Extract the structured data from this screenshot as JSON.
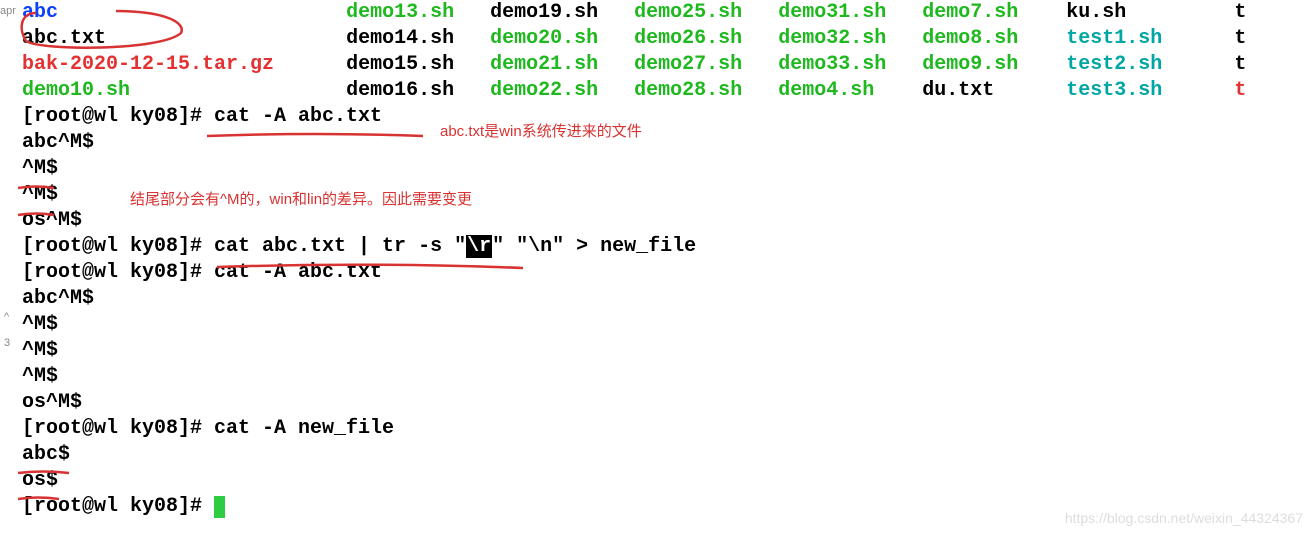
{
  "leftLabels": {
    "a": "apr",
    "b": "^",
    "c": "3"
  },
  "prompt": "[root@wl ky08]# ",
  "ls_rows": [
    [
      {
        "t": "abc",
        "c": "blue"
      },
      {
        "t": "demo13.sh",
        "c": "green"
      },
      {
        "t": "demo19.sh",
        "c": "black"
      },
      {
        "t": "demo25.sh",
        "c": "green"
      },
      {
        "t": "demo31.sh",
        "c": "green"
      },
      {
        "t": "demo7.sh",
        "c": "green"
      },
      {
        "t": "ku.sh",
        "c": "black"
      },
      {
        "t": "t",
        "c": "black"
      }
    ],
    [
      {
        "t": "abc.txt",
        "c": "black"
      },
      {
        "t": "demo14.sh",
        "c": "black"
      },
      {
        "t": "demo20.sh",
        "c": "green"
      },
      {
        "t": "demo26.sh",
        "c": "green"
      },
      {
        "t": "demo32.sh",
        "c": "green"
      },
      {
        "t": "demo8.sh",
        "c": "green"
      },
      {
        "t": "test1.sh",
        "c": "teal"
      },
      {
        "t": "t",
        "c": "black"
      }
    ],
    [
      {
        "t": "bak-2020-12-15.tar.gz",
        "c": "red"
      },
      {
        "t": "demo15.sh",
        "c": "black"
      },
      {
        "t": "demo21.sh",
        "c": "green"
      },
      {
        "t": "demo27.sh",
        "c": "green"
      },
      {
        "t": "demo33.sh",
        "c": "green"
      },
      {
        "t": "demo9.sh",
        "c": "green"
      },
      {
        "t": "test2.sh",
        "c": "teal"
      },
      {
        "t": "t",
        "c": "black"
      }
    ],
    [
      {
        "t": "demo10.sh",
        "c": "green"
      },
      {
        "t": "demo16.sh",
        "c": "black"
      },
      {
        "t": "demo22.sh",
        "c": "green"
      },
      {
        "t": "demo28.sh",
        "c": "green"
      },
      {
        "t": "demo4.sh",
        "c": "green"
      },
      {
        "t": "du.txt",
        "c": "black"
      },
      {
        "t": "test3.sh",
        "c": "teal"
      },
      {
        "t": "t",
        "c": "red"
      }
    ]
  ],
  "cmd1": "cat -A abc.txt",
  "out1": [
    "abc^M$",
    "^M$",
    "^M$",
    "os^M$"
  ],
  "cmd2_a": "cat abc.txt | tr -s \"",
  "cmd2_inv": "\\r",
  "cmd2_b": "\" \"\\n\" > new_file",
  "cmd3": "cat -A abc.txt",
  "out3": [
    "abc^M$",
    "^M$",
    "^M$",
    "^M$",
    "os^M$"
  ],
  "cmd4": "cat -A new_file",
  "out4": [
    "abc$",
    "os$"
  ],
  "anno1": "abc.txt是win系统传进来的文件",
  "anno2": "结尾部分会有^M的，win和lin的差异。因此需要变更",
  "watermark": "https://blog.csdn.net/weixin_44324367"
}
